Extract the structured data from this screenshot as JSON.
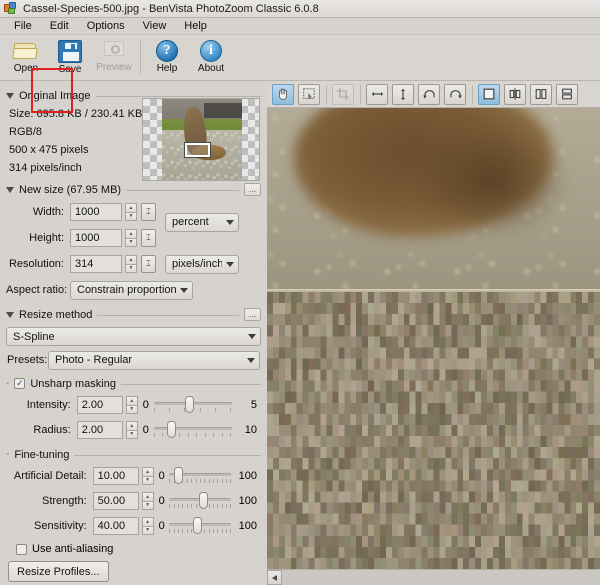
{
  "window": {
    "title": "Cassel-Species-500.jpg - BenVista PhotoZoom Classic 6.0.8",
    "app_icon": "app-logo-icon"
  },
  "menubar": {
    "items": [
      {
        "label": "File"
      },
      {
        "label": "Edit"
      },
      {
        "label": "Options"
      },
      {
        "label": "View"
      },
      {
        "label": "Help"
      }
    ]
  },
  "toolbar": {
    "buttons": [
      {
        "label": "Open",
        "icon": "folder-open-icon",
        "enabled": true
      },
      {
        "label": "Save",
        "icon": "floppy-disk-icon",
        "enabled": true,
        "highlighted": true
      },
      {
        "label": "Preview",
        "icon": "preview-magnifier-icon",
        "enabled": false
      },
      {
        "label": "Help",
        "icon": "question-mark-icon",
        "enabled": true
      },
      {
        "label": "About",
        "icon": "info-icon",
        "enabled": true
      }
    ],
    "help_glyph": "?",
    "about_glyph": "i",
    "highlight_color": "#e02020"
  },
  "original_image": {
    "section_title": "Original Image",
    "lines": [
      "Size: 695.8 KB / 230.41 KB",
      "RGB/8",
      "500 x 475 pixels",
      "314 pixels/inch"
    ]
  },
  "new_size": {
    "section_title": "New size (67.95 MB)",
    "options_button": "...",
    "width": {
      "label": "Width:",
      "value": "1000"
    },
    "height": {
      "label": "Height:",
      "value": "1000"
    },
    "resolution": {
      "label": "Resolution:",
      "value": "314"
    },
    "unit_combo": {
      "value": "percent"
    },
    "resolution_unit_combo": {
      "value": "pixels/inch"
    },
    "aspect_ratio": {
      "label": "Aspect ratio:",
      "value": "Constrain proportions"
    },
    "lock_glyph": "⌶",
    "spin_up": "▲",
    "spin_down": "▼"
  },
  "resize_method": {
    "section_title": "Resize method",
    "options_button": "...",
    "method_combo": {
      "value": "S-Spline"
    },
    "presets": {
      "label": "Presets:",
      "value": "Photo - Regular"
    },
    "unsharp_masking": {
      "label": "Unsharp masking",
      "checked": true,
      "check_glyph": "✓"
    },
    "intensity": {
      "label": "Intensity:",
      "value": "2.00",
      "min": "0",
      "max": "5",
      "percent": 40
    },
    "radius": {
      "label": "Radius:",
      "value": "2.00",
      "min": "0",
      "max": "10",
      "percent": 20
    }
  },
  "fine_tuning": {
    "section_title": "Fine-tuning",
    "artificial_detail": {
      "label": "Artificial Detail:",
      "value": "10.00",
      "min": "0",
      "max": "100",
      "percent": 10
    },
    "strength": {
      "label": "Strength:",
      "value": "50.00",
      "min": "0",
      "max": "100",
      "percent": 50
    },
    "sensitivity": {
      "label": "Sensitivity:",
      "value": "40.00",
      "min": "0",
      "max": "100",
      "percent": 40
    },
    "anti_aliasing": {
      "label": "Use anti-aliasing",
      "checked": false
    },
    "resize_profiles_button": "Resize Profiles..."
  },
  "preview_toolbar": {
    "tools": [
      {
        "name": "hand-tool",
        "icon": "hand-icon",
        "active": true,
        "enabled": true
      },
      {
        "name": "marquee-select-tool",
        "icon": "marquee-select-icon",
        "active": false,
        "enabled": true
      },
      {
        "name": "crop-tool",
        "icon": "crop-icon",
        "active": false,
        "enabled": false
      },
      {
        "name": "flip-horizontal",
        "icon": "flip-horizontal-icon",
        "active": false,
        "enabled": true
      },
      {
        "name": "flip-vertical",
        "icon": "flip-vertical-icon",
        "active": false,
        "enabled": true
      },
      {
        "name": "rotate-left",
        "icon": "rotate-left-icon",
        "active": false,
        "enabled": true
      },
      {
        "name": "rotate-right",
        "icon": "rotate-right-icon",
        "active": false,
        "enabled": true
      },
      {
        "name": "view-single",
        "icon": "single-pane-icon",
        "active": true,
        "enabled": true
      },
      {
        "name": "view-split",
        "icon": "split-pane-icon",
        "active": false,
        "enabled": true
      },
      {
        "name": "view-side-by-side",
        "icon": "side-by-side-icon",
        "active": false,
        "enabled": true
      },
      {
        "name": "view-stacked",
        "icon": "stacked-pane-icon",
        "active": false,
        "enabled": true
      }
    ]
  },
  "preview": {
    "top_description": "smooth-interpolated-zoom",
    "bottom_description": "pixelated-original-zoom"
  },
  "scrollbar": {
    "left_arrow": "◀"
  },
  "colors": {
    "window_bg": "#d6d2ce",
    "accent_blue": "#2f79b5",
    "highlight_red": "#e02020",
    "active_tool": "#8fbddd"
  }
}
